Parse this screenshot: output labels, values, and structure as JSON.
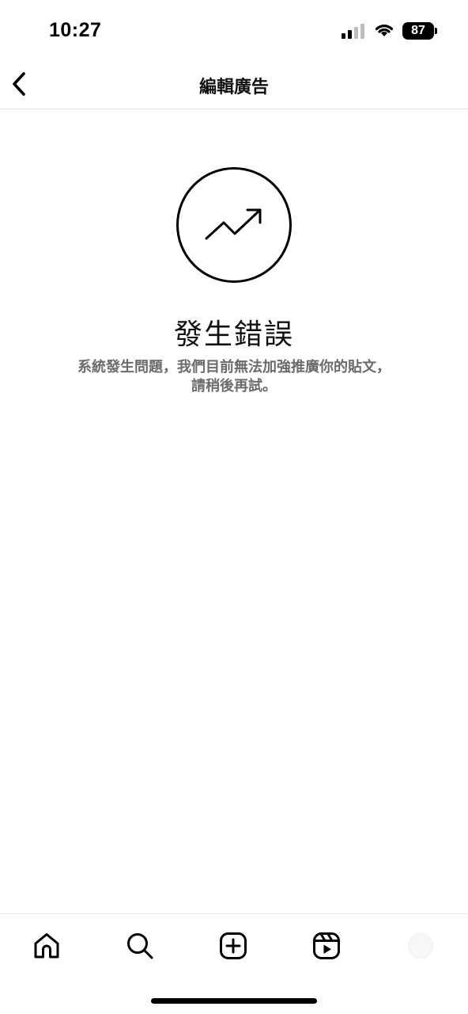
{
  "status_bar": {
    "time": "10:27",
    "battery": "87",
    "signal_icon": "cellular-signal-icon",
    "wifi_icon": "wifi-icon"
  },
  "nav": {
    "title": "編輯廣告",
    "back_icon": "chevron-left-icon"
  },
  "error": {
    "icon": "trending-up-icon",
    "title": "發生錯誤",
    "message_line1": "系統發生問題，我們目前無法加強推廣你的貼文，",
    "message_line2": "請稍後再試。"
  },
  "tab_bar": {
    "items": [
      {
        "icon": "home-icon"
      },
      {
        "icon": "search-icon"
      },
      {
        "icon": "plus-square-icon"
      },
      {
        "icon": "reels-icon"
      },
      {
        "icon": "profile-avatar"
      }
    ]
  },
  "colors": {
    "text_primary": "#111111",
    "text_secondary": "#6b6b6b",
    "divider": "#e3e3e3",
    "background": "#ffffff"
  }
}
